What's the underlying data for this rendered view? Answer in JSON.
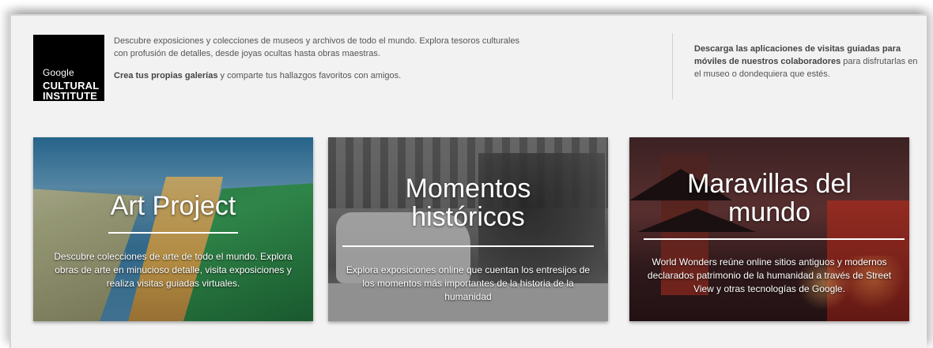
{
  "logo": {
    "brand": "Google",
    "line1": "CULTURAL",
    "line2": "INSTITUTE"
  },
  "intro": {
    "paragraph1": "Descubre exposiciones y colecciones de museos y archivos de todo el mundo. Explora tesoros culturales con profusión de detalles, desde joyas ocultas hasta obras maestras.",
    "paragraph2_bold": "Crea tus propias galerías",
    "paragraph2_rest": " y comparte tus hallazgos favoritos con amigos."
  },
  "apps": {
    "bold": "Descarga las aplicaciones de visitas guiadas para móviles de nuestros colaboradores",
    "rest": " para disfrutarlas en el museo o dondequiera que estés."
  },
  "cards": [
    {
      "title": "Art Project",
      "description": "Descubre colecciones de arte de todo el mundo. Explora obras de arte en minucioso detalle, visita exposiciones y realiza visitas guiadas virtuales."
    },
    {
      "title_line1": "Momentos",
      "title_line2": "históricos",
      "description": "Explora exposiciones online que cuentan los entresijos de los momentos más importantes de la historia de la humanidad"
    },
    {
      "title_line1": "Maravillas del",
      "title_line2": "mundo",
      "description": "World Wonders reúne online sitios antiguos y modernos declarados patrimonio de la humanidad a través de Street View y otras tecnologías de Google."
    }
  ]
}
